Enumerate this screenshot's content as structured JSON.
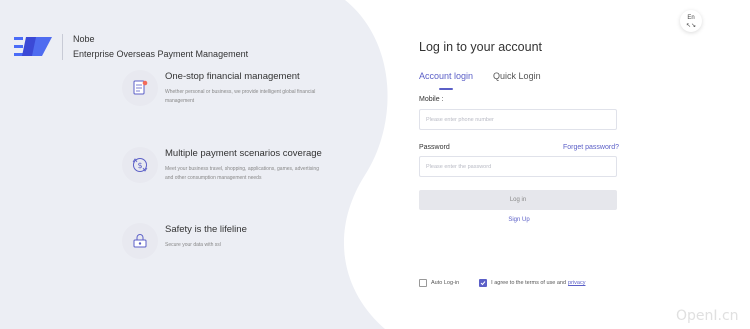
{
  "brand": {
    "name": "Nobe",
    "subtitle": "Enterprise Overseas Payment Management"
  },
  "features": [
    {
      "title": "One-stop financial management",
      "desc": "Whether personal or business, we provide intelligent global financial management",
      "icon": "document-icon"
    },
    {
      "title": "Multiple payment scenarios coverage",
      "desc": "Meet your business travel, shopping, applications, games, advertising and other consumption management needs",
      "icon": "payment-exchange-icon"
    },
    {
      "title": "Safety is the lifeline",
      "desc": "Secure your data with ssl",
      "icon": "shield-lock-icon"
    }
  ],
  "language": {
    "line1": "En",
    "line2": "↖↘"
  },
  "login": {
    "title": "Log in to your account",
    "tab_account": "Account login",
    "tab_quick": "Quick Login",
    "mobile_label": "Mobile :",
    "mobile_placeholder": "Please enter phone number",
    "password_label": "Password",
    "forget": "Forget password?",
    "password_placeholder": "Please enter the password",
    "login_button": "Log in",
    "signup": "Sign Up",
    "auto_login": "Auto Log-in",
    "agree_text": "I agree to the terms of use and",
    "privacy": "privacy"
  },
  "watermark": "OpenI.cn",
  "colors": {
    "accent": "#5b5fc7",
    "left_bg": "#eceef4"
  }
}
